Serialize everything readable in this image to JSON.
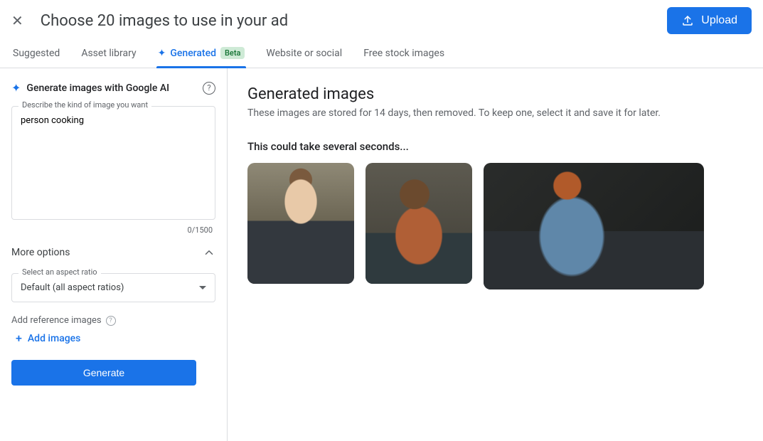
{
  "header": {
    "title": "Choose 20 images to use in your ad",
    "upload_label": "Upload"
  },
  "tabs": {
    "suggested": "Suggested",
    "asset_library": "Asset library",
    "generated": "Generated",
    "beta_badge": "Beta",
    "website_or_social": "Website or social",
    "free_stock": "Free stock images"
  },
  "sidebar": {
    "heading": "Generate images with Google AI",
    "prompt_label": "Describe the kind of image you want",
    "prompt_value": "person cooking",
    "char_count": "0/1500",
    "more_options": "More options",
    "aspect_label": "Select an aspect ratio",
    "aspect_value": "Default (all aspect ratios)",
    "reference_label": "Add reference images",
    "add_images": "Add images",
    "generate_button": "Generate"
  },
  "main": {
    "title": "Generated images",
    "subtitle": "These images are stored for 14 days, then removed. To keep one, select it and save it for later.",
    "loading": "This could take several seconds..."
  }
}
